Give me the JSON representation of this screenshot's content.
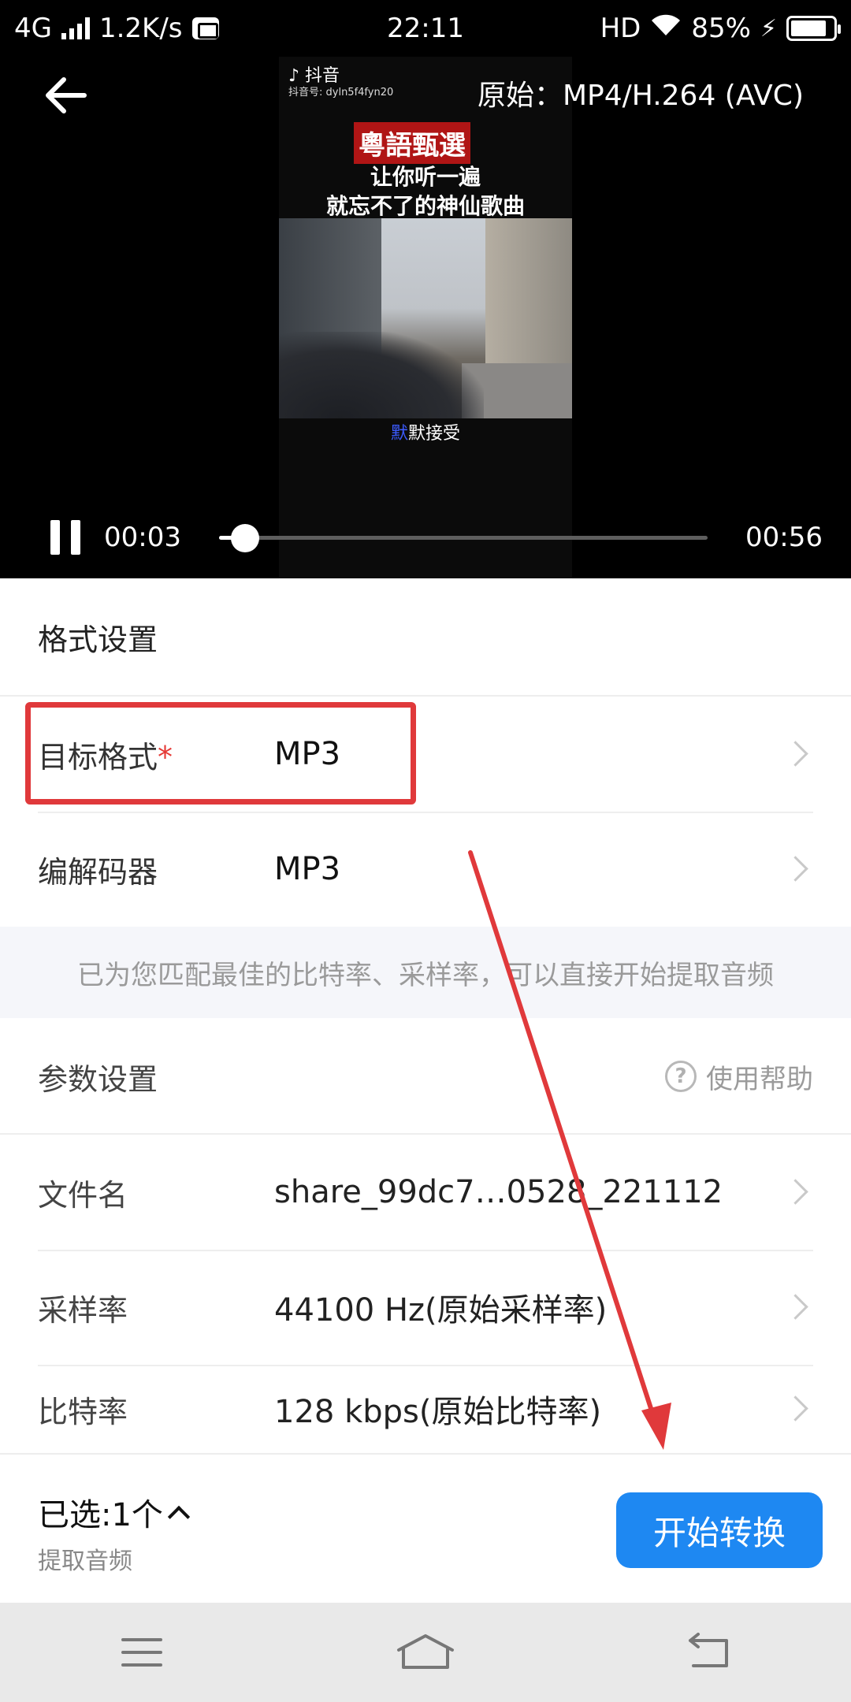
{
  "status_bar": {
    "network": "4G",
    "speed": "1.2K/s",
    "time": "22:11",
    "hd": "HD",
    "battery": "85%",
    "battery_level": 0.85
  },
  "player": {
    "format_label": "原始：MP4/H.264 (AVC)",
    "tiktok_name": "抖音",
    "tiktok_id": "抖音号: dyln5f4fyn20",
    "video_title": "粵語甄選",
    "caption_line1": "让你听一遍",
    "caption_line2": "就忘不了的神仙歌曲",
    "subtitle_highlight": "默",
    "subtitle_rest": "默接受",
    "current_time": "00:03",
    "total_time": "00:56",
    "progress": 0.054
  },
  "format_section": {
    "title": "格式设置",
    "target_label": "目标格式",
    "required_mark": "*",
    "target_value": "MP3",
    "codec_label": "编解码器",
    "codec_value": "MP3"
  },
  "hint": "已为您匹配最佳的比特率、采样率，可以直接开始提取音频",
  "params_section": {
    "title": "参数设置",
    "help_label": "使用帮助",
    "help_glyph": "?",
    "filename_label": "文件名",
    "filename_value": "share_99dc7…0528_221112",
    "samplerate_label": "采样率",
    "samplerate_value": "44100 Hz(原始采样率)",
    "bitrate_label": "比特率",
    "bitrate_value": "128 kbps(原始比特率)"
  },
  "action_bar": {
    "selected_label": "已选:1个",
    "mode_label": "提取音频",
    "start_button": "开始转换"
  },
  "colors": {
    "accent": "#1e88f2",
    "annotation": "#e0393b",
    "required": "#e53935"
  },
  "icons": {
    "back": "arrow-left-icon",
    "pause": "pause-icon",
    "help": "question-circle-icon",
    "menu": "menu-icon",
    "home": "home-icon",
    "back_nav": "return-icon"
  }
}
